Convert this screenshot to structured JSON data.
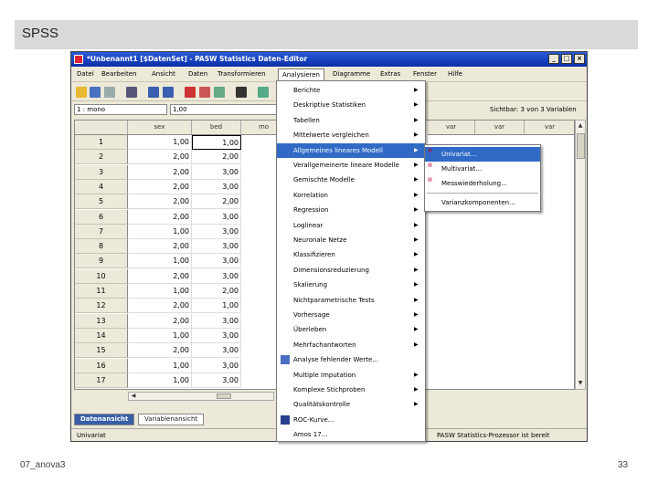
{
  "slide": {
    "title": "SPSS",
    "footer_left": "07_anova3",
    "page_number": "33"
  },
  "window": {
    "title": "*Unbenannt1 [$DatenSet] - PASW Statistics Daten-Editor",
    "btn_min": "_",
    "btn_max": "□",
    "btn_close": "×"
  },
  "menubar": [
    {
      "label": "Datei"
    },
    {
      "label": "Bearbeiten"
    },
    {
      "label": "Ansicht"
    },
    {
      "label": "Daten"
    },
    {
      "label": "Transformieren"
    },
    {
      "label": "Analysieren"
    },
    {
      "label": "Diagramme"
    },
    {
      "label": "Extras"
    },
    {
      "label": "Fenster"
    },
    {
      "label": "Hilfe"
    }
  ],
  "cellbar": {
    "ref": "1 : mono",
    "value": "1,00",
    "sichtbar": "Sichtbar: 3 von 3 Variablen"
  },
  "grid": {
    "columns": [
      "sex",
      "bed",
      "mo"
    ],
    "right_columns": [
      "var",
      "var",
      "var"
    ],
    "rows": [
      {
        "n": "1",
        "sex": "1,00",
        "bed": "1,00"
      },
      {
        "n": "2",
        "sex": "2,00",
        "bed": "2,00"
      },
      {
        "n": "3",
        "sex": "2,00",
        "bed": "3,00"
      },
      {
        "n": "4",
        "sex": "2,00",
        "bed": "3,00"
      },
      {
        "n": "5",
        "sex": "2,00",
        "bed": "2,00"
      },
      {
        "n": "6",
        "sex": "2,00",
        "bed": "3,00"
      },
      {
        "n": "7",
        "sex": "1,00",
        "bed": "3,00"
      },
      {
        "n": "8",
        "sex": "2,00",
        "bed": "3,00"
      },
      {
        "n": "9",
        "sex": "1,00",
        "bed": "3,00"
      },
      {
        "n": "10",
        "sex": "2,00",
        "bed": "3,00"
      },
      {
        "n": "11",
        "sex": "1,00",
        "bed": "2,00"
      },
      {
        "n": "12",
        "sex": "2,00",
        "bed": "1,00"
      },
      {
        "n": "13",
        "sex": "2,00",
        "bed": "3,00"
      },
      {
        "n": "14",
        "sex": "1,00",
        "bed": "3,00"
      },
      {
        "n": "15",
        "sex": "2,00",
        "bed": "3,00"
      },
      {
        "n": "16",
        "sex": "1,00",
        "bed": "3,00"
      },
      {
        "n": "17",
        "sex": "1,00",
        "bed": "3,00"
      }
    ]
  },
  "tabs": {
    "data_view": "Datenansicht",
    "variable_view": "Variablenansicht"
  },
  "status": {
    "left": "Univariat",
    "right": "PASW Statistics-Prozessor ist bereit"
  },
  "dropdown": [
    {
      "label": "Berichte",
      "arrow": "▶"
    },
    {
      "label": "Deskriptive Statistiken",
      "arrow": "▶"
    },
    {
      "label": "Tabellen",
      "arrow": "▶"
    },
    {
      "label": "Mittelwerte vergleichen",
      "arrow": "▶"
    },
    {
      "label": "Allgemeines lineares Modell",
      "arrow": "▶"
    },
    {
      "label": "Verallgemeinerte lineare Modelle",
      "arrow": "▶"
    },
    {
      "label": "Gemischte Modelle",
      "arrow": "▶"
    },
    {
      "label": "Korrelation",
      "arrow": "▶"
    },
    {
      "label": "Regression",
      "arrow": "▶"
    },
    {
      "label": "Loglinear",
      "arrow": "▶"
    },
    {
      "label": "Neuronale Netze",
      "arrow": "▶"
    },
    {
      "label": "Klassifizieren",
      "arrow": "▶"
    },
    {
      "label": "Dimensionsreduzierung",
      "arrow": "▶"
    },
    {
      "label": "Skalierung",
      "arrow": "▶"
    },
    {
      "label": "Nichtparametrische Tests",
      "arrow": "▶"
    },
    {
      "label": "Vorhersage",
      "arrow": "▶"
    },
    {
      "label": "Überleben",
      "arrow": "▶"
    },
    {
      "label": "Mehrfachantworten",
      "arrow": "▶"
    },
    {
      "label": "Analyse fehlender Werte...",
      "arrow": ""
    },
    {
      "label": "Multiple Imputation",
      "arrow": "▶"
    },
    {
      "label": "Komplexe Stichproben",
      "arrow": "▶"
    },
    {
      "label": "Qualitätskontrolle",
      "arrow": "▶"
    },
    {
      "label": "ROC-Kurve...",
      "arrow": ""
    },
    {
      "label": "Amos 17...",
      "arrow": ""
    }
  ],
  "submenu": [
    {
      "label": "Univariat..."
    },
    {
      "label": "Multivariat..."
    },
    {
      "label": "Messwiederholung..."
    },
    {
      "label": "Varianzkomponenten..."
    }
  ],
  "colors": {
    "highlight": "#316ac5",
    "titlebar": "#0a2ea8",
    "tab_active": "#395fa8"
  }
}
